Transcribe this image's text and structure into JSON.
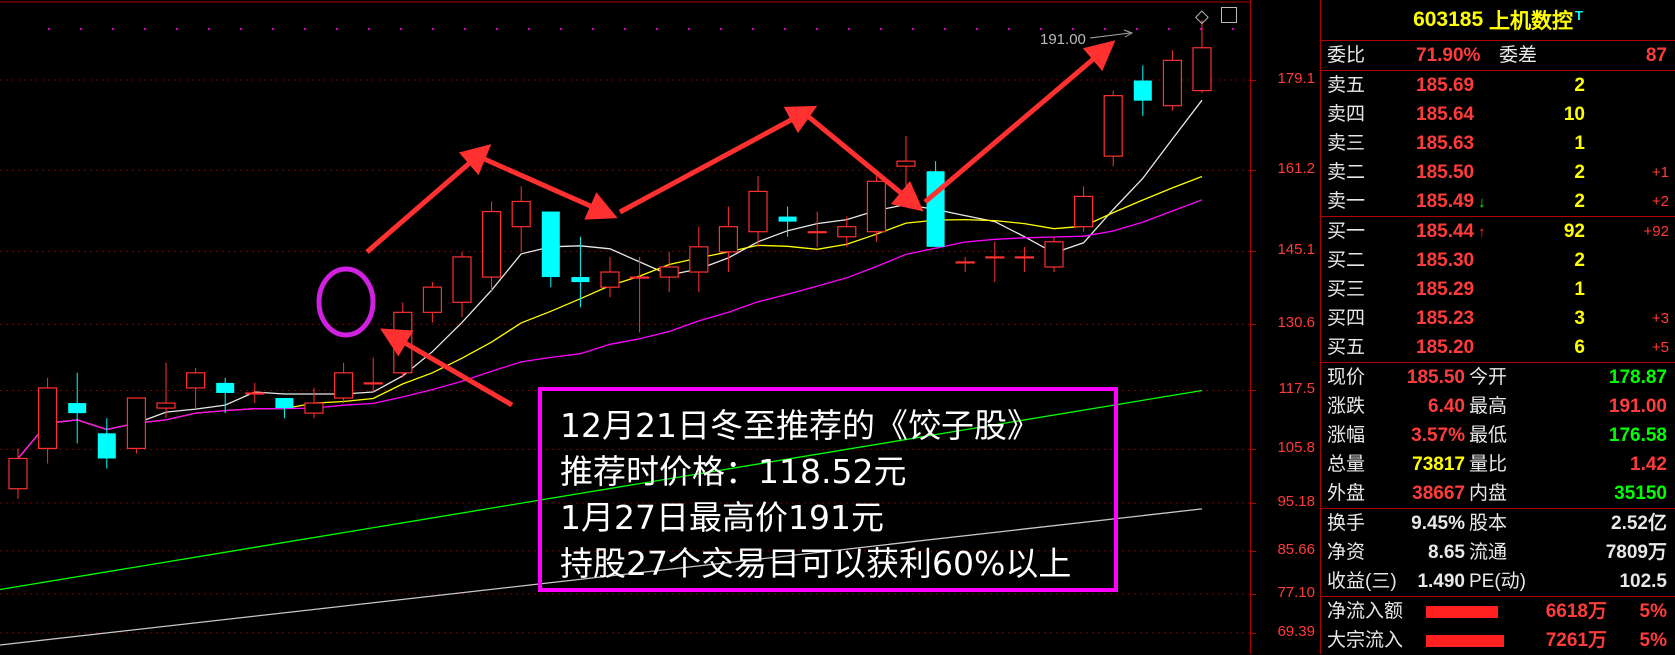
{
  "stock": {
    "code": "603185",
    "name": "上机数控",
    "tag": "T"
  },
  "chart_data": {
    "type": "candlestick",
    "ylim": [
      66,
      192
    ],
    "y_ticks": [
      "179.1",
      "161.2",
      "145.1",
      "130.6",
      "117.5",
      "105.8",
      "95.18",
      "85.66",
      "77.10",
      "69.39"
    ],
    "y_tick_values": [
      179.1,
      161.2,
      145.1,
      130.6,
      117.5,
      105.8,
      95.18,
      85.66,
      77.1,
      69.39
    ],
    "high_label": "191.00",
    "candles": [
      {
        "o": 98,
        "h": 106,
        "l": 96,
        "c": 104
      },
      {
        "o": 106,
        "h": 120,
        "l": 103,
        "c": 118
      },
      {
        "o": 115,
        "h": 121,
        "l": 107,
        "c": 113
      },
      {
        "o": 109,
        "h": 112,
        "l": 102,
        "c": 104
      },
      {
        "o": 106,
        "h": 116,
        "l": 105,
        "c": 116
      },
      {
        "o": 114,
        "h": 123,
        "l": 112,
        "c": 115
      },
      {
        "o": 118,
        "h": 122,
        "l": 114,
        "c": 121
      },
      {
        "o": 119,
        "h": 120,
        "l": 113,
        "c": 117
      },
      {
        "o": 117,
        "h": 119,
        "l": 115,
        "c": 117
      },
      {
        "o": 116,
        "h": 116,
        "l": 112,
        "c": 114
      },
      {
        "o": 113,
        "h": 118,
        "l": 112,
        "c": 115
      },
      {
        "o": 116,
        "h": 123,
        "l": 115,
        "c": 121
      },
      {
        "o": 119,
        "h": 124,
        "l": 117,
        "c": 119
      },
      {
        "o": 121,
        "h": 135,
        "l": 120,
        "c": 133
      },
      {
        "o": 133,
        "h": 139,
        "l": 131,
        "c": 138
      },
      {
        "o": 135,
        "h": 145,
        "l": 132,
        "c": 144
      },
      {
        "o": 140,
        "h": 155,
        "l": 137,
        "c": 153
      },
      {
        "o": 150,
        "h": 158,
        "l": 145,
        "c": 155
      },
      {
        "o": 153,
        "h": 153,
        "l": 138,
        "c": 140
      },
      {
        "o": 140,
        "h": 148,
        "l": 134,
        "c": 139
      },
      {
        "o": 138,
        "h": 144,
        "l": 136,
        "c": 141
      },
      {
        "o": 140,
        "h": 144,
        "l": 129,
        "c": 140
      },
      {
        "o": 140,
        "h": 145,
        "l": 137,
        "c": 142
      },
      {
        "o": 141,
        "h": 150,
        "l": 137,
        "c": 146
      },
      {
        "o": 145,
        "h": 154,
        "l": 141,
        "c": 150
      },
      {
        "o": 149,
        "h": 160,
        "l": 146,
        "c": 157
      },
      {
        "o": 152,
        "h": 154,
        "l": 148,
        "c": 151
      },
      {
        "o": 149,
        "h": 153,
        "l": 146,
        "c": 149
      },
      {
        "o": 148,
        "h": 152,
        "l": 146,
        "c": 150
      },
      {
        "o": 149,
        "h": 160,
        "l": 147,
        "c": 159
      },
      {
        "o": 162,
        "h": 168,
        "l": 157,
        "c": 163
      },
      {
        "o": 161,
        "h": 163,
        "l": 146,
        "c": 146
      },
      {
        "o": 143,
        "h": 144,
        "l": 141,
        "c": 143
      },
      {
        "o": 144,
        "h": 147,
        "l": 139,
        "c": 144
      },
      {
        "o": 144,
        "h": 146,
        "l": 141,
        "c": 144
      },
      {
        "o": 142,
        "h": 148,
        "l": 141,
        "c": 147
      },
      {
        "o": 150,
        "h": 158,
        "l": 149,
        "c": 156
      },
      {
        "o": 164,
        "h": 177,
        "l": 162,
        "c": 176
      },
      {
        "o": 179,
        "h": 182,
        "l": 172,
        "c": 175
      },
      {
        "o": 174,
        "h": 185,
        "l": 173,
        "c": 183
      },
      {
        "o": 177,
        "h": 191,
        "l": 176.5,
        "c": 185.5
      }
    ],
    "ma_colors": [
      "#e8e8e8",
      "#ffff00",
      "#ff00ff",
      "#00ff00",
      "#c8c8c8"
    ]
  },
  "annotation": {
    "lines": [
      "12月21日冬至推荐的《饺子股》",
      "推荐时价格：118.52元",
      "1月27日最高价191元",
      "持股27个交易日可以获利60%以上"
    ]
  },
  "panel": {
    "wb": {
      "label": "委比",
      "value": "71.90%",
      "label2": "委差",
      "value2": "87"
    },
    "asks": [
      {
        "label": "卖五",
        "price": "185.69",
        "vol": "2",
        "chg": ""
      },
      {
        "label": "卖四",
        "price": "185.64",
        "vol": "10",
        "chg": ""
      },
      {
        "label": "卖三",
        "price": "185.63",
        "vol": "1",
        "chg": ""
      },
      {
        "label": "卖二",
        "price": "185.50",
        "vol": "2",
        "chg": "+1"
      },
      {
        "label": "卖一",
        "price": "185.49",
        "vol": "2",
        "chg": "+2"
      }
    ],
    "bids": [
      {
        "label": "买一",
        "price": "185.44",
        "vol": "92",
        "chg": "+92"
      },
      {
        "label": "买二",
        "price": "185.30",
        "vol": "2",
        "chg": ""
      },
      {
        "label": "买三",
        "price": "185.29",
        "vol": "1",
        "chg": ""
      },
      {
        "label": "买四",
        "price": "185.23",
        "vol": "3",
        "chg": "+3"
      },
      {
        "label": "买五",
        "price": "185.20",
        "vol": "6",
        "chg": "+5"
      }
    ],
    "quote": [
      {
        "l": "现价",
        "v": "185.50",
        "l2": "今开",
        "v2": "178.87",
        "c1": "red",
        "c2": "grn"
      },
      {
        "l": "涨跌",
        "v": "6.40",
        "l2": "最高",
        "v2": "191.00",
        "c1": "red",
        "c2": "red"
      },
      {
        "l": "涨幅",
        "v": "3.57%",
        "l2": "最低",
        "v2": "176.58",
        "c1": "red",
        "c2": "grn"
      },
      {
        "l": "总量",
        "v": "73817",
        "l2": "量比",
        "v2": "1.42",
        "c1": "yel",
        "c2": "red"
      },
      {
        "l": "外盘",
        "v": "38667",
        "l2": "内盘",
        "v2": "35150",
        "c1": "red",
        "c2": "grn"
      }
    ],
    "fund": [
      {
        "l": "换手",
        "v": "9.45%",
        "l2": "股本",
        "v2": "2.52亿"
      },
      {
        "l": "净资",
        "v": "8.65",
        "l2": "流通",
        "v2": "7809万"
      },
      {
        "l": "收益(三)",
        "v": "1.490",
        "l2": "PE(动)",
        "v2": "102.5"
      }
    ],
    "flows": [
      {
        "l": "净流入额",
        "bar": 0.72,
        "v": "6618万",
        "p": "5%"
      },
      {
        "l": "大宗流入",
        "bar": 0.78,
        "v": "7261万",
        "p": "5%"
      }
    ]
  }
}
